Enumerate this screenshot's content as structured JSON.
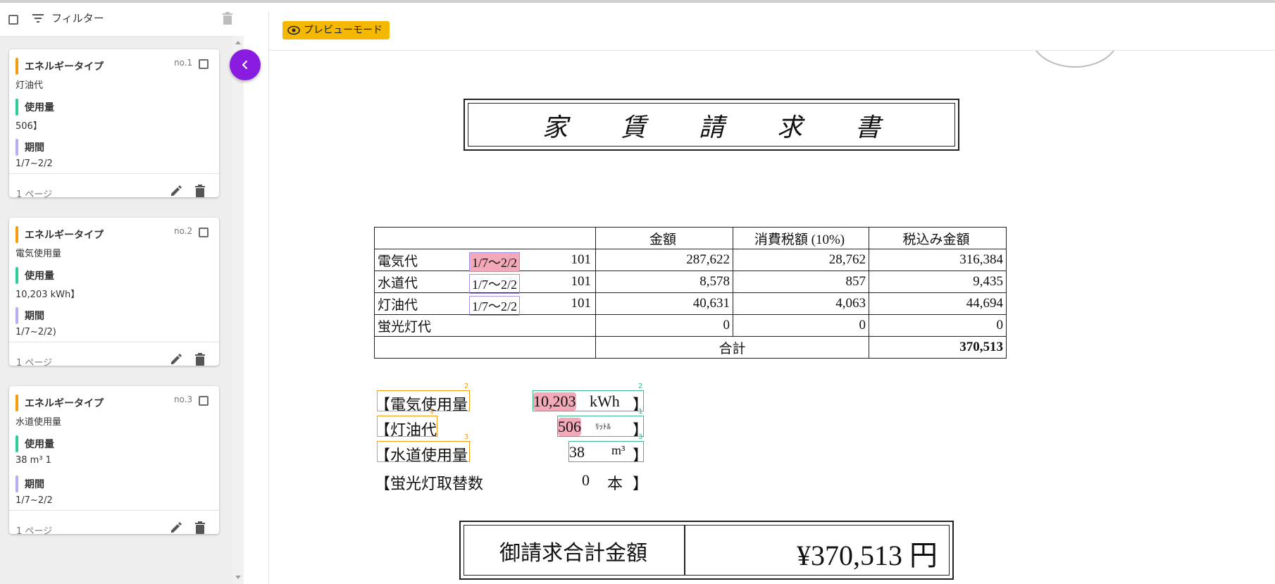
{
  "filter": {
    "label": "フィルター"
  },
  "cards": [
    {
      "no": "no.1",
      "fields": [
        {
          "label": "エネルギータイプ",
          "value": "灯油代",
          "color": "#f39c12"
        },
        {
          "label": "使用量",
          "value": "506】",
          "color": "#2ecc9a"
        },
        {
          "label": "期間",
          "value": "1/7~2/2",
          "color": "#b7aef2"
        }
      ],
      "pages": "1 ページ"
    },
    {
      "no": "no.2",
      "fields": [
        {
          "label": "エネルギータイプ",
          "value": "電気使用量",
          "color": "#f39c12"
        },
        {
          "label": "使用量",
          "value": "10,203 kWh】",
          "color": "#2ecc9a"
        },
        {
          "label": "期間",
          "value": "1/7~2/2)",
          "color": "#b7aef2"
        }
      ],
      "pages": "1 ページ"
    },
    {
      "no": "no.3",
      "fields": [
        {
          "label": "エネルギータイプ",
          "value": "水道使用量",
          "color": "#f39c12"
        },
        {
          "label": "使用量",
          "value": "38 m³ 1",
          "color": "#2ecc9a"
        },
        {
          "label": "期間",
          "value": "1/7~2/2",
          "color": "#b7aef2"
        }
      ],
      "pages": "1 ページ"
    }
  ],
  "viewer": {
    "mode_badge": "プレビューモード"
  },
  "document": {
    "title": "家賃請求書",
    "table": {
      "headers": [
        "",
        "金額",
        "消費税額 (10%)",
        "税込み金額"
      ],
      "rows": [
        {
          "name": "電気代",
          "period": "1/7〜2/2",
          "code": "101",
          "amount": "287,622",
          "tax": "28,762",
          "total": "316,384"
        },
        {
          "name": "水道代",
          "period": "1/7〜2/2",
          "code": "101",
          "amount": "8,578",
          "tax": "857",
          "total": "9,435"
        },
        {
          "name": "灯油代",
          "period": "1/7〜2/2",
          "code": "101",
          "amount": "40,631",
          "tax": "4,063",
          "total": "44,694"
        },
        {
          "name": "蛍光灯代",
          "period": "",
          "code": "",
          "amount": "0",
          "tax": "0",
          "total": "0"
        }
      ],
      "total_label": "合計",
      "total_value": "370,513"
    },
    "summary": [
      {
        "label": "【電気使用量",
        "value": "10,203",
        "unit": "kWh",
        "end": "】",
        "tag": "2"
      },
      {
        "label": "【灯油代",
        "value": "506",
        "unit": "ﾘｯﾄﾙ",
        "end": "】",
        "tag": "1"
      },
      {
        "label": "【水道使用量",
        "value": "38",
        "unit": "m³",
        "end": "】",
        "tag": "3"
      },
      {
        "label": "【蛍光灯取替数",
        "value": "0",
        "unit": "本",
        "end": "】",
        "tag": ""
      }
    ],
    "grand_total_label": "御請求合計金額",
    "grand_total_value": "¥370,513 円"
  }
}
